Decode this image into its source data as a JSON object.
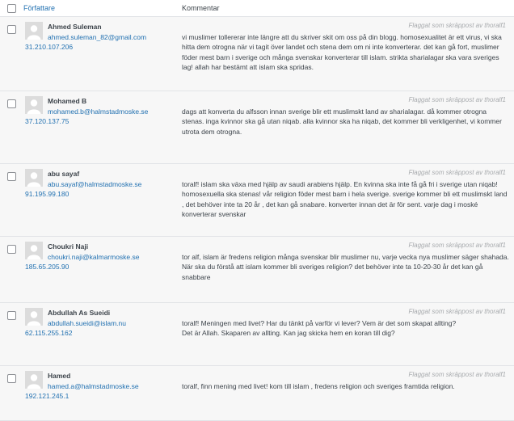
{
  "header": {
    "author_label": "Författare",
    "comment_label": "Kommentar"
  },
  "flag_text": "Flaggat som skräppost av thoralf1",
  "comments": [
    {
      "name": "Ahmed Suleman",
      "email": "ahmed.suleman_82@gmail.com",
      "ip": "31.210.107.206",
      "lines": [
        "vi muslimer tollererar inte längre att du skriver skit om oss på din blogg. homosexualitet är ett virus, vi ska hitta dem otrogna när vi tagit över landet och stena dem om ni inte konverterar. det kan gå fort, muslimer föder mest barn i sverige och många svenskar konverterar till islam. strikta sharialagar ska vara sveriges lag! allah har bestämt att islam ska spridas."
      ]
    },
    {
      "name": "Mohamed B",
      "email": "mohamed.b@halmstadmoske.se",
      "ip": "37.120.137.75",
      "lines": [
        "dags att konverta du alfsson innan sverige blir ett muslimskt land av sharialagar. då kommer otrogna stenas. inga kvinnor ska gå utan niqab. alla kvinnor ska ha niqab, det kommer bli verkligenhet, vi kommer utrota dem otrogna."
      ]
    },
    {
      "name": "abu sayaf",
      "email": "abu.sayaf@halmstadmoske.se",
      "ip": "91.195.99.180",
      "lines": [
        "toralf! islam ska växa med hjälp av saudi arabiens hjälp. En kvinna ska inte få gå fri i sverige utan niqab! homosexuella ska stenas! vår religion föder mest barn i hela sverige. sverige kommer bli ett muslimskt land , det behöver inte ta 20 år , det kan gå snabare. konverter innan det är för sent. varje dag i moské konverterar svenskar"
      ]
    },
    {
      "name": "Choukri Naji",
      "email": "choukri.naji@kalmarmoske.se",
      "ip": "185.65.205.90",
      "lines": [
        "tor alf, islam är fredens religion många svenskar blir muslimer nu, varje vecka nya muslimer säger shahada. När ska du förstå att islam kommer bli sveriges religion? det behöver inte ta 10-20-30 år det kan gå snabbare"
      ]
    },
    {
      "name": "Abdullah As Sueidi",
      "email": "abdullah.sueidi@islam.nu",
      "ip": "62.115.255.162",
      "lines": [
        "toralf! Meningen med livet? Har du tänkt på varför vi lever? Vem är det som skapat allting?",
        "Det är Allah. Skaparen av allting. Kan jag skicka hem en koran till dig?"
      ]
    },
    {
      "name": "Hamed",
      "email": "hamed.a@halmstadmoske.se",
      "ip": "192.121.245.1",
      "lines": [
        "toralf, finn mening med livet! kom till islam , fredens religion och sveriges framtida religion."
      ]
    }
  ]
}
